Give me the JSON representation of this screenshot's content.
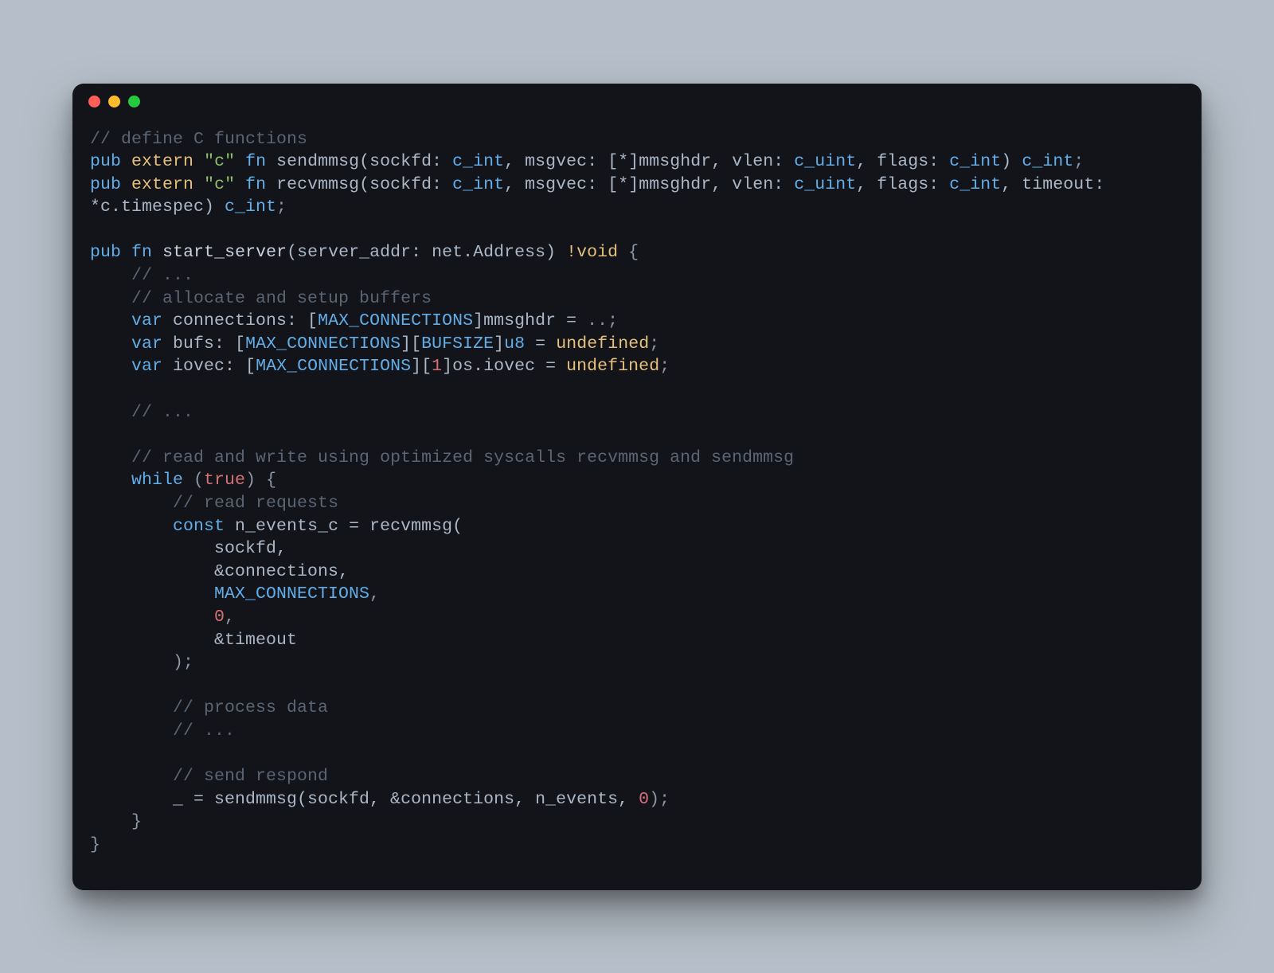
{
  "colors": {
    "page_bg": "#b6bfc9",
    "window_bg": "#12141a",
    "traffic_red": "#ff5f56",
    "traffic_yellow": "#ffbd2e",
    "traffic_green": "#27c93f",
    "comment": "#5b6573",
    "keyword": "#62aee9",
    "extern": "#e5c07b",
    "string": "#8ebd6b",
    "number": "#d27277",
    "default": "#c4cddb"
  },
  "code_lines": [
    "// define C functions",
    "pub extern \"c\" fn sendmmsg(sockfd: c_int, msgvec: [*]mmsghdr, vlen: c_uint, flags: c_int) c_int;",
    "pub extern \"c\" fn recvmmsg(sockfd: c_int, msgvec: [*]mmsghdr, vlen: c_uint, flags: c_int, timeout: *c.timespec) c_int;",
    "",
    "pub fn start_server(server_addr: net.Address) !void {",
    "    // ...",
    "    // allocate and setup buffers",
    "    var connections: [MAX_CONNECTIONS]mmsghdr = ..;",
    "    var bufs: [MAX_CONNECTIONS][BUFSIZE]u8 = undefined;",
    "    var iovec: [MAX_CONNECTIONS][1]os.iovec = undefined;",
    "",
    "    // ...",
    "",
    "    // read and write using optimized syscalls recvmmsg and sendmmsg",
    "    while (true) {",
    "        // read requests",
    "        const n_events_c = recvmmsg(",
    "            sockfd,",
    "            &connections,",
    "            MAX_CONNECTIONS,",
    "            0,",
    "            &timeout",
    "        );",
    "",
    "        // process data",
    "        // ...",
    "",
    "        // send respond",
    "        _ = sendmmsg(sockfd, &connections, n_events, 0);",
    "    }",
    "}"
  ],
  "tokens": [
    [
      {
        "t": "// define C functions",
        "c": "c-comment"
      }
    ],
    [
      {
        "t": "pub",
        "c": "c-kw"
      },
      {
        "t": " ",
        "c": ""
      },
      {
        "t": "extern",
        "c": "c-extern"
      },
      {
        "t": " ",
        "c": ""
      },
      {
        "t": "\"c\"",
        "c": "c-str"
      },
      {
        "t": " ",
        "c": ""
      },
      {
        "t": "fn",
        "c": "c-kw"
      },
      {
        "t": " sendmmsg(sockfd: ",
        "c": "c-fn"
      },
      {
        "t": "c_int",
        "c": "c-type"
      },
      {
        "t": ", msgvec: [*]mmsghdr, vlen: ",
        "c": "c-fn"
      },
      {
        "t": "c_uint",
        "c": "c-type"
      },
      {
        "t": ", flags: ",
        "c": "c-fn"
      },
      {
        "t": "c_int",
        "c": "c-type"
      },
      {
        "t": ") ",
        "c": "c-fn"
      },
      {
        "t": "c_int",
        "c": "c-type"
      },
      {
        "t": ";",
        "c": "c-punct"
      }
    ],
    [
      {
        "t": "pub",
        "c": "c-kw"
      },
      {
        "t": " ",
        "c": ""
      },
      {
        "t": "extern",
        "c": "c-extern"
      },
      {
        "t": " ",
        "c": ""
      },
      {
        "t": "\"c\"",
        "c": "c-str"
      },
      {
        "t": " ",
        "c": ""
      },
      {
        "t": "fn",
        "c": "c-kw"
      },
      {
        "t": " recvmmsg(sockfd: ",
        "c": "c-fn"
      },
      {
        "t": "c_int",
        "c": "c-type"
      },
      {
        "t": ", msgvec: [*]mmsghdr, vlen: ",
        "c": "c-fn"
      },
      {
        "t": "c_uint",
        "c": "c-type"
      },
      {
        "t": ", flags: ",
        "c": "c-fn"
      },
      {
        "t": "c_int",
        "c": "c-type"
      },
      {
        "t": ", timeout: ",
        "c": "c-fn"
      },
      {
        "t": "\n",
        "c": ""
      },
      {
        "t": "*c.timespec) ",
        "c": "c-fn"
      },
      {
        "t": "c_int",
        "c": "c-type"
      },
      {
        "t": ";",
        "c": "c-punct"
      }
    ],
    [
      {
        "t": "",
        "c": ""
      }
    ],
    [
      {
        "t": "pub",
        "c": "c-kw"
      },
      {
        "t": " ",
        "c": ""
      },
      {
        "t": "fn",
        "c": "c-kw"
      },
      {
        "t": " ",
        "c": ""
      },
      {
        "t": "start_server",
        "c": "c-call"
      },
      {
        "t": "(server_addr: net.Address) ",
        "c": "c-fn"
      },
      {
        "t": "!void",
        "c": "c-extern"
      },
      {
        "t": " {",
        "c": "c-punct"
      }
    ],
    [
      {
        "t": "    ",
        "c": ""
      },
      {
        "t": "// ...",
        "c": "c-comment"
      }
    ],
    [
      {
        "t": "    ",
        "c": ""
      },
      {
        "t": "// allocate and setup buffers",
        "c": "c-comment"
      }
    ],
    [
      {
        "t": "    ",
        "c": ""
      },
      {
        "t": "var",
        "c": "c-kw"
      },
      {
        "t": " connections: [",
        "c": "c-fn"
      },
      {
        "t": "MAX_CONNECTIONS",
        "c": "c-const"
      },
      {
        "t": "]mmsghdr = ",
        "c": "c-fn"
      },
      {
        "t": "..",
        "c": "c-punct"
      },
      {
        "t": ";",
        "c": "c-punct"
      }
    ],
    [
      {
        "t": "    ",
        "c": ""
      },
      {
        "t": "var",
        "c": "c-kw"
      },
      {
        "t": " bufs: [",
        "c": "c-fn"
      },
      {
        "t": "MAX_CONNECTIONS",
        "c": "c-const"
      },
      {
        "t": "][",
        "c": "c-fn"
      },
      {
        "t": "BUFSIZE",
        "c": "c-const"
      },
      {
        "t": "]",
        "c": "c-fn"
      },
      {
        "t": "u8",
        "c": "c-type"
      },
      {
        "t": " = ",
        "c": "c-fn"
      },
      {
        "t": "undefined",
        "c": "c-extern"
      },
      {
        "t": ";",
        "c": "c-punct"
      }
    ],
    [
      {
        "t": "    ",
        "c": ""
      },
      {
        "t": "var",
        "c": "c-kw"
      },
      {
        "t": " iovec: [",
        "c": "c-fn"
      },
      {
        "t": "MAX_CONNECTIONS",
        "c": "c-const"
      },
      {
        "t": "][",
        "c": "c-fn"
      },
      {
        "t": "1",
        "c": "c-num"
      },
      {
        "t": "]os.iovec = ",
        "c": "c-fn"
      },
      {
        "t": "undefined",
        "c": "c-extern"
      },
      {
        "t": ";",
        "c": "c-punct"
      }
    ],
    [
      {
        "t": "",
        "c": ""
      }
    ],
    [
      {
        "t": "    ",
        "c": ""
      },
      {
        "t": "// ...",
        "c": "c-comment"
      }
    ],
    [
      {
        "t": "",
        "c": ""
      }
    ],
    [
      {
        "t": "    ",
        "c": ""
      },
      {
        "t": "// read and write using optimized syscalls recvmmsg and sendmmsg",
        "c": "c-comment"
      }
    ],
    [
      {
        "t": "    ",
        "c": ""
      },
      {
        "t": "while",
        "c": "c-kw"
      },
      {
        "t": " (",
        "c": "c-punct"
      },
      {
        "t": "true",
        "c": "c-true"
      },
      {
        "t": ") {",
        "c": "c-punct"
      }
    ],
    [
      {
        "t": "        ",
        "c": ""
      },
      {
        "t": "// read requests",
        "c": "c-comment"
      }
    ],
    [
      {
        "t": "        ",
        "c": ""
      },
      {
        "t": "const",
        "c": "c-kw"
      },
      {
        "t": " n_events_c = recvmmsg(",
        "c": "c-fn"
      }
    ],
    [
      {
        "t": "            sockfd,",
        "c": "c-fn"
      }
    ],
    [
      {
        "t": "            &connections,",
        "c": "c-fn"
      }
    ],
    [
      {
        "t": "            ",
        "c": ""
      },
      {
        "t": "MAX_CONNECTIONS",
        "c": "c-const"
      },
      {
        "t": ",",
        "c": "c-punct"
      }
    ],
    [
      {
        "t": "            ",
        "c": ""
      },
      {
        "t": "0",
        "c": "c-num"
      },
      {
        "t": ",",
        "c": "c-punct"
      }
    ],
    [
      {
        "t": "            &timeout",
        "c": "c-fn"
      }
    ],
    [
      {
        "t": "        );",
        "c": "c-punct"
      }
    ],
    [
      {
        "t": "",
        "c": ""
      }
    ],
    [
      {
        "t": "        ",
        "c": ""
      },
      {
        "t": "// process data",
        "c": "c-comment"
      }
    ],
    [
      {
        "t": "        ",
        "c": ""
      },
      {
        "t": "// ...",
        "c": "c-comment"
      }
    ],
    [
      {
        "t": "",
        "c": ""
      }
    ],
    [
      {
        "t": "        ",
        "c": ""
      },
      {
        "t": "// send respond",
        "c": "c-comment"
      }
    ],
    [
      {
        "t": "        _ = sendmmsg(sockfd, &connections, n_events, ",
        "c": "c-fn"
      },
      {
        "t": "0",
        "c": "c-num"
      },
      {
        "t": ");",
        "c": "c-punct"
      }
    ],
    [
      {
        "t": "    }",
        "c": "c-punct"
      }
    ],
    [
      {
        "t": "}",
        "c": "c-punct"
      }
    ]
  ]
}
